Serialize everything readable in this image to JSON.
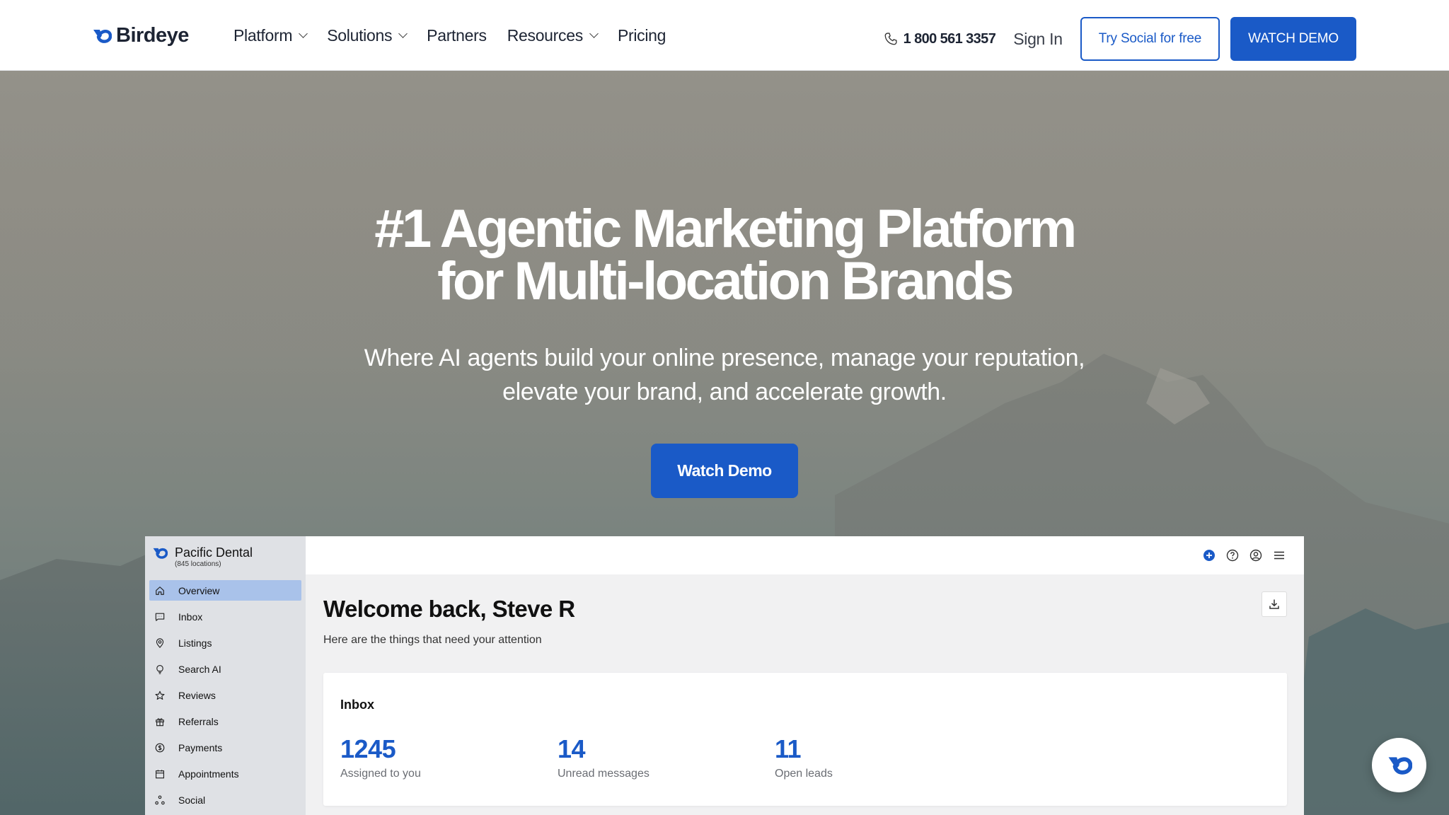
{
  "brand": {
    "name": "Birdeye",
    "accent": "#1a5ac7"
  },
  "nav": {
    "items": [
      {
        "label": "Platform",
        "has_dropdown": true
      },
      {
        "label": "Solutions",
        "has_dropdown": true
      },
      {
        "label": "Partners",
        "has_dropdown": false
      },
      {
        "label": "Resources",
        "has_dropdown": true
      },
      {
        "label": "Pricing",
        "has_dropdown": false
      }
    ],
    "phone": "1 800 561 3357",
    "phone_icon": "phone-icon",
    "sign_in": "Sign In",
    "try_social": "Try Social for free",
    "watch_demo": "WATCH DEMO"
  },
  "hero": {
    "title_line1": "#1 Agentic Marketing Platform",
    "title_line2": "for Multi-location Brands",
    "subtitle_line1": "Where AI agents build your online presence, manage your reputation,",
    "subtitle_line2": "elevate your brand, and accelerate growth.",
    "cta": "Watch Demo"
  },
  "dashboard": {
    "business_name": "Pacific Dental",
    "business_sub": "(845 locations)",
    "menu": [
      {
        "label": "Overview",
        "icon": "home-icon",
        "active": true
      },
      {
        "label": "Inbox",
        "icon": "message-icon",
        "active": false
      },
      {
        "label": "Listings",
        "icon": "location-pin-icon",
        "active": false
      },
      {
        "label": "Search AI",
        "icon": "lightbulb-icon",
        "active": false
      },
      {
        "label": "Reviews",
        "icon": "star-icon",
        "active": false
      },
      {
        "label": "Referrals",
        "icon": "gift-icon",
        "active": false
      },
      {
        "label": "Payments",
        "icon": "dollar-icon",
        "active": false
      },
      {
        "label": "Appointments",
        "icon": "calendar-icon",
        "active": false
      },
      {
        "label": "Social",
        "icon": "share-icon",
        "active": false
      }
    ],
    "top_icons": [
      "add-icon",
      "help-icon",
      "account-icon",
      "menu-icon"
    ],
    "welcome": "Welcome back, Steve R",
    "welcome_sub": "Here are the things that need your attention",
    "inbox": {
      "title": "Inbox",
      "stats": [
        {
          "value": "1245",
          "label": "Assigned to you"
        },
        {
          "value": "14",
          "label": "Unread messages"
        },
        {
          "value": "11",
          "label": "Open leads"
        }
      ]
    }
  },
  "chat_widget": {
    "icon": "birdeye-chat-icon"
  }
}
